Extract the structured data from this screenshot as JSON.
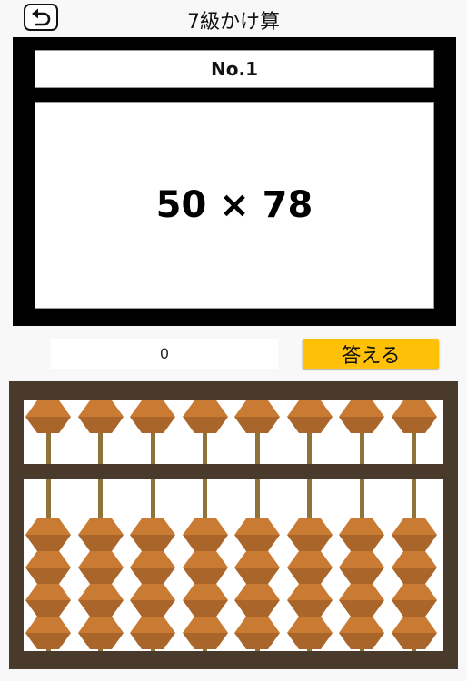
{
  "header": {
    "title": "7級かけ算",
    "back_icon": "undo-arrow-icon"
  },
  "problem": {
    "number_label": "No.1",
    "expression": "50 × 78"
  },
  "answer": {
    "value": "0",
    "submit_label": "答える",
    "submit_color": "#ffc107"
  },
  "abacus": {
    "rods": 8,
    "upper_beads_per_rod": 1,
    "lower_beads_per_rod": 4,
    "frame_color": "#4a3a2b",
    "bead_color": "#c97a33",
    "rod_color": "#8f7339"
  }
}
